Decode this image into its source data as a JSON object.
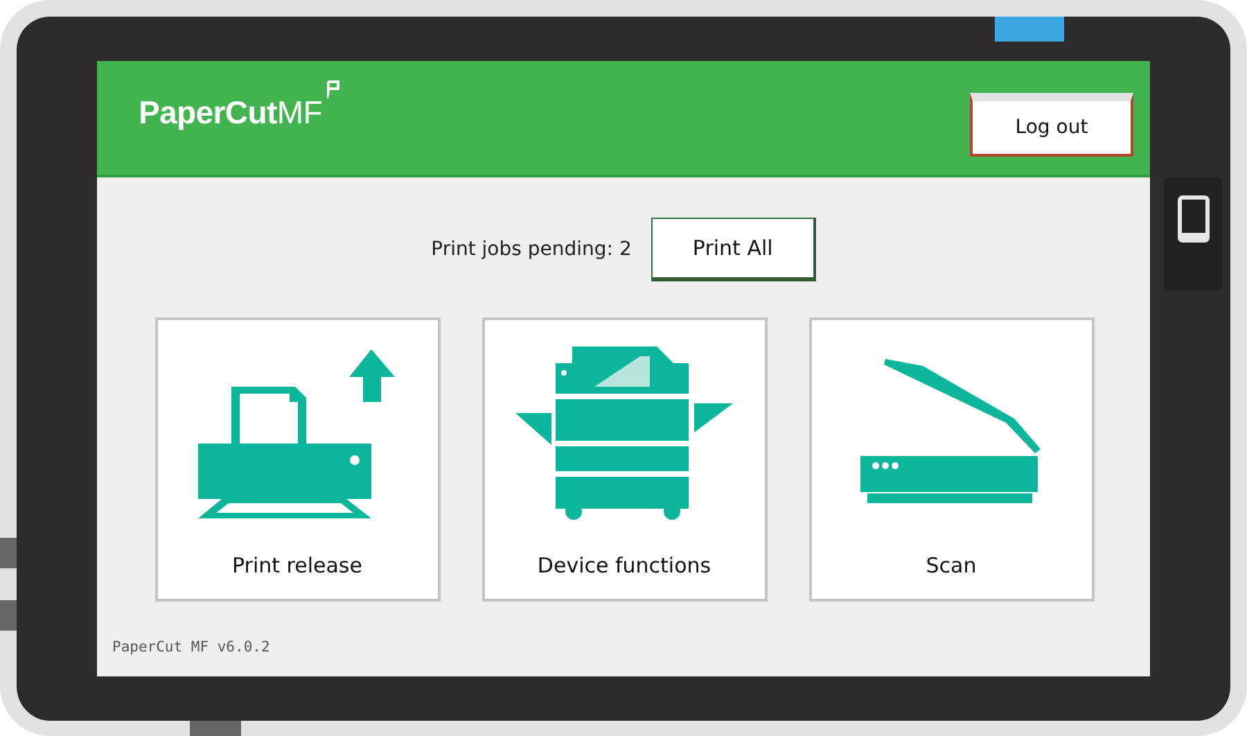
{
  "header": {
    "logo": "**PaperCut**MF",
    "logout_button": "Log out"
  },
  "pending": {
    "label": "Print jobs pending: 2",
    "button": "Print All"
  },
  "tiles": [
    {
      "kind": "print_release",
      "label": "Print release"
    },
    {
      "kind": "device_functions",
      "label": "Device functions"
    },
    {
      "kind": "scan",
      "label": "Scan"
    }
  ],
  "version": "PaperCut MF v6.0.2"
}
